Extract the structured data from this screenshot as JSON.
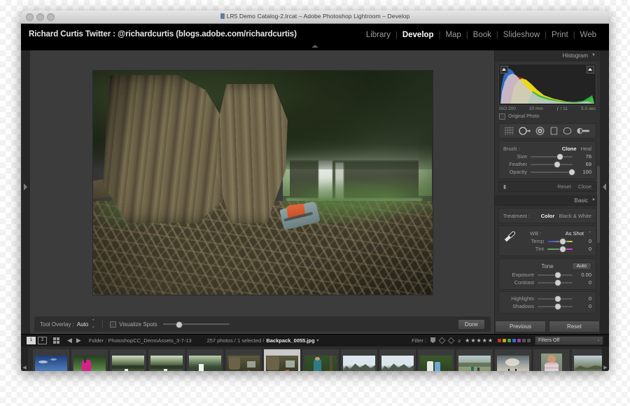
{
  "window": {
    "title": "LR5 Demo Catalog-2.lrcat – Adobe Photoshop Lightroom – Develop",
    "title_icon": "document-icon"
  },
  "topbar": {
    "identity_plate": "Richard Curtis Twitter : @richardcurtis (blogs.adobe.com/richardcurtis)",
    "modules": [
      {
        "label": "Library",
        "active": false
      },
      {
        "label": "Develop",
        "active": true
      },
      {
        "label": "Map",
        "active": false
      },
      {
        "label": "Book",
        "active": false
      },
      {
        "label": "Slideshow",
        "active": false
      },
      {
        "label": "Print",
        "active": false
      },
      {
        "label": "Web",
        "active": false
      }
    ],
    "separator": "|"
  },
  "right_panel": {
    "histogram": {
      "title": "Histogram",
      "caret": "▼",
      "iso": "ISO 200",
      "focal": "20 mm",
      "aperture": "ƒ / 11",
      "shutter": "5.0 sec",
      "original_photo_label": "Original Photo"
    },
    "tool_strip": [
      "crop-overlay-icon",
      "spot-removal-icon",
      "red-eye-icon",
      "graduated-filter-icon",
      "radial-filter-icon",
      "adjustment-brush-icon"
    ],
    "spot_removal": {
      "brush_label": "Brush :",
      "clone_label": "Clone",
      "heal_label": "Heal",
      "clone_active": true,
      "sliders": [
        {
          "label": "Size",
          "value": "76",
          "pos": 62
        },
        {
          "label": "Feather",
          "value": "69",
          "pos": 55
        },
        {
          "label": "Opacity",
          "value": "100",
          "pos": 92
        }
      ],
      "reset_label": "Reset",
      "close_label": "Close"
    },
    "basic": {
      "title": "Basic",
      "caret": "▼",
      "treatment_label": "Treatment :",
      "color_label": "Color",
      "bw_label": "Black & White",
      "wb_label": "WB :",
      "wb_value": "As Shot",
      "wb_caret": "⌃",
      "wb_sliders": [
        {
          "label": "Temp",
          "value": "0",
          "pos": 50,
          "track": "temp"
        },
        {
          "label": "Tint",
          "value": "0",
          "pos": 50,
          "track": "tint"
        }
      ],
      "tone_label": "Tone",
      "auto_label": "Auto",
      "tone_sliders": [
        {
          "label": "Exposure",
          "value": "0.00",
          "pos": 50
        },
        {
          "label": "Contrast",
          "value": "0",
          "pos": 50
        },
        {
          "label": "Highlights",
          "value": "0",
          "pos": 50
        },
        {
          "label": "Shadows",
          "value": "0",
          "pos": 50
        }
      ]
    }
  },
  "image_toolbar": {
    "tool_overlay_label": "Tool Overlay :",
    "tool_overlay_value": "Auto",
    "visualize_spots_label": "Visualize Spots",
    "done_label": "Done"
  },
  "action_buttons": {
    "previous_label": "Previous",
    "reset_label": "Reset"
  },
  "filmstrip_bar": {
    "view1": "1",
    "view2": "2",
    "grid_icon": "grid-view-icon",
    "back_icon": "navigate-back-icon",
    "forward_icon": "navigate-forward-icon",
    "folder_label": "Folder : PhotoshopCC_DemoAssets_3-7-13",
    "count_label": "257 photos / 1 selected /",
    "selected_file": "Backpack_0055.jpg",
    "file_caret": "▾",
    "filter_label": "Filter :",
    "rating_operator": "≥",
    "stars": "★★★★★",
    "color_labels": [
      "#c0392b",
      "#c9a227",
      "#4f9e4f",
      "#3b6fc4",
      "#8e44ad",
      "#555555",
      "#555555"
    ],
    "filters_off_label": "Filters Off",
    "filters_caret": "⌄"
  },
  "filmstrip": {
    "left_arrow": "◀",
    "right_arrow": "▶",
    "thumbnails": [
      {
        "name": "sky-paraglider-thumb",
        "selected": false,
        "badge": true,
        "badge2": false,
        "dots": 0,
        "theme": "sky"
      },
      {
        "name": "zipline-pink-thumb",
        "selected": false,
        "badge": true,
        "badge2": true,
        "dots": 0,
        "theme": "zip"
      },
      {
        "name": "waterfall-1-thumb",
        "selected": false,
        "badge": true,
        "badge2": false,
        "dots": 0,
        "theme": "falls"
      },
      {
        "name": "waterfall-2-thumb",
        "selected": false,
        "badge": true,
        "badge2": false,
        "dots": 0,
        "theme": "falls"
      },
      {
        "name": "waterfall-3-thumb",
        "selected": false,
        "badge": true,
        "badge2": false,
        "dots": 0,
        "theme": "falls2"
      },
      {
        "name": "backpack-roots-thumb",
        "selected": false,
        "badge": true,
        "badge2": false,
        "dots": 0,
        "theme": "roots"
      },
      {
        "name": "backpack-0055-thumb",
        "selected": true,
        "badge": true,
        "badge2": true,
        "dots": 0,
        "theme": "roots"
      },
      {
        "name": "hiker-trail-thumb",
        "selected": false,
        "badge": true,
        "badge2": true,
        "dots": 0,
        "theme": "hiker"
      },
      {
        "name": "mountain-group-1-thumb",
        "selected": false,
        "badge": true,
        "badge2": false,
        "dots": 1,
        "theme": "mtn"
      },
      {
        "name": "mountain-group-2-thumb",
        "selected": false,
        "badge": true,
        "badge2": false,
        "dots": 1,
        "theme": "mtn"
      },
      {
        "name": "jungle-group-thumb",
        "selected": false,
        "badge": true,
        "badge2": true,
        "dots": 4,
        "theme": "jungle"
      },
      {
        "name": "field-runners-thumb",
        "selected": false,
        "badge": true,
        "badge2": false,
        "dots": 1,
        "theme": "field"
      },
      {
        "name": "clouds-silhouette-thumb",
        "selected": false,
        "badge": true,
        "badge2": false,
        "dots": 0,
        "theme": "clouds"
      },
      {
        "name": "portrait-woman-thumb",
        "selected": false,
        "badge": true,
        "badge2": false,
        "dots": 1,
        "theme": "portrait"
      },
      {
        "name": "valley-edge-thumb",
        "selected": false,
        "badge": false,
        "badge2": false,
        "dots": 1,
        "theme": "valley"
      }
    ]
  },
  "panels": {
    "left_collapse_icon": "panel-expand-right-icon",
    "right_collapse_icon": "panel-expand-left-icon",
    "top_collapse_icon": "panel-collapse-up-icon",
    "bottom_collapse_icon": "panel-collapse-down-icon"
  },
  "colors": {
    "panel_bg": "#323232",
    "stage_bg": "#3c3c3c",
    "accent_text": "#ffffff"
  }
}
